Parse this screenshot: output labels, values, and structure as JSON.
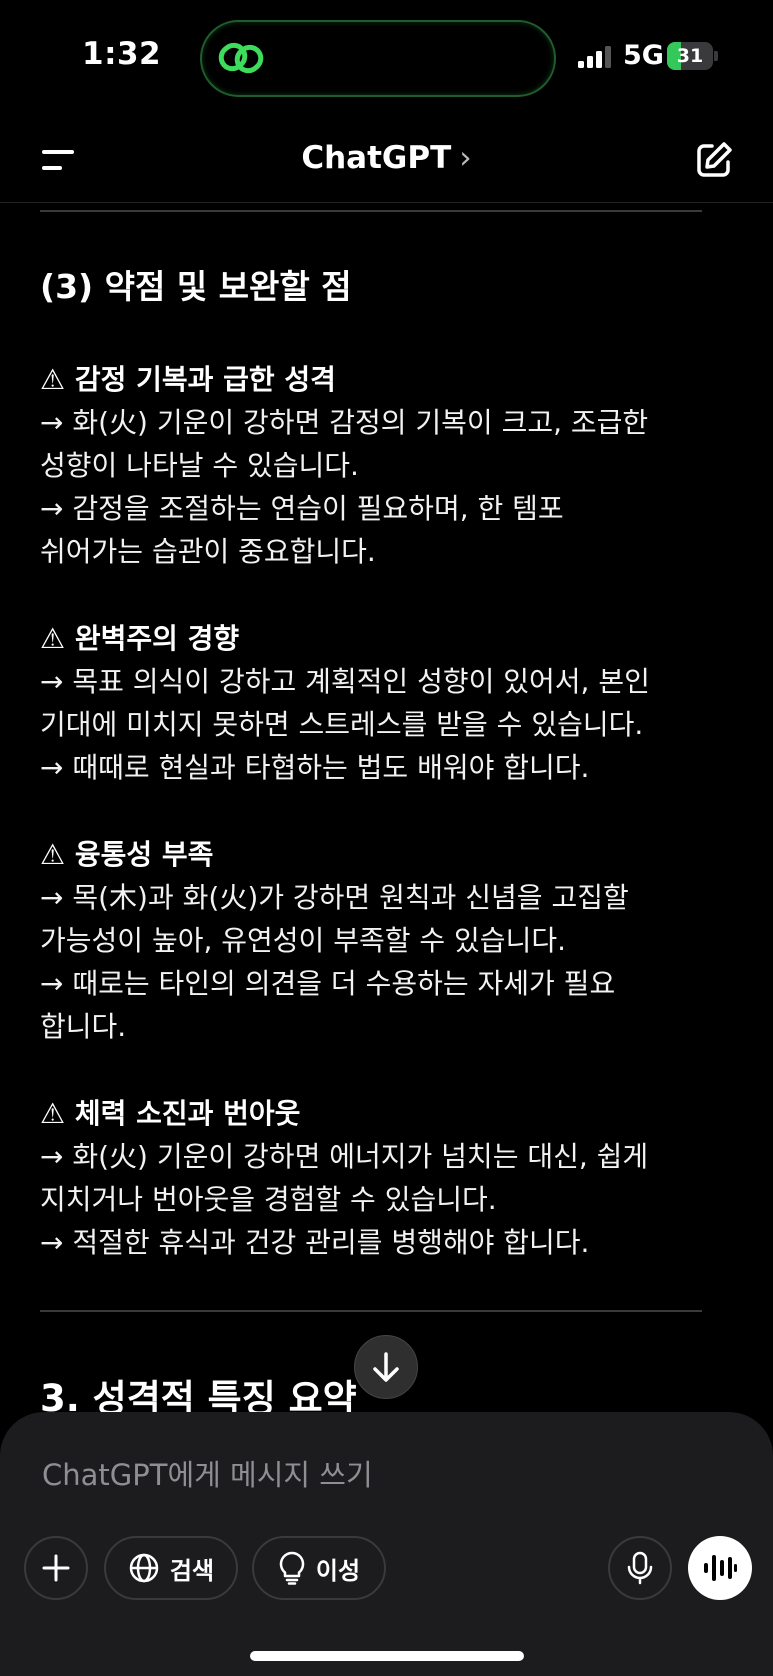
{
  "status_bar": {
    "time": "1:32",
    "network": "5G",
    "battery": "31",
    "battery_level": 0.31
  },
  "nav": {
    "title": "ChatGPT",
    "chevron": "›"
  },
  "content": {
    "section_heading": "(3) 약점 및 보완할 점",
    "items": [
      {
        "title": "⚠ 감정 기복과 급한 성격",
        "lines": [
          "→ 화(火) 기운이 강하면 감정의 기복이 크고, 조급한",
          "성향이 나타날 수 있습니다.",
          "→ 감정을 조절하는 연습이 필요하며, 한 템포",
          "쉬어가는 습관이 중요합니다."
        ]
      },
      {
        "title": "⚠ 완벽주의 경향",
        "lines": [
          "→ 목표 의식이 강하고 계획적인 성향이 있어서, 본인",
          "기대에 미치지 못하면 스트레스를 받을 수 있습니다.",
          "→ 때때로 현실과 타협하는 법도 배워야 합니다."
        ]
      },
      {
        "title": "⚠ 융통성 부족",
        "lines": [
          "→ 목(木)과 화(火)가 강하면 원칙과 신념을 고집할",
          "가능성이 높아, 유연성이 부족할 수 있습니다.",
          "→ 때로는 타인의 의견을 더 수용하는 자세가 필요",
          "합니다."
        ]
      },
      {
        "title": "⚠ 체력 소진과 번아웃",
        "lines": [
          "→ 화(火) 기운이 강하면 에너지가 넘치는 대신, 쉽게",
          "지치거나 번아웃을 경험할 수 있습니다.",
          "→ 적절한 휴식과 건강 관리를 병행해야 합니다."
        ]
      }
    ],
    "next_heading": "3. 성격적 특징 요약"
  },
  "composer": {
    "placeholder": "ChatGPT에게 메시지 쓰기",
    "search_label": "검색",
    "reason_label": "이성"
  },
  "icons": [
    "menu-icon",
    "new-chat-icon",
    "arrow-down-icon",
    "plus-icon",
    "globe-icon",
    "lightbulb-icon",
    "mic-icon",
    "voice-wave-icon",
    "link-app-icon"
  ]
}
